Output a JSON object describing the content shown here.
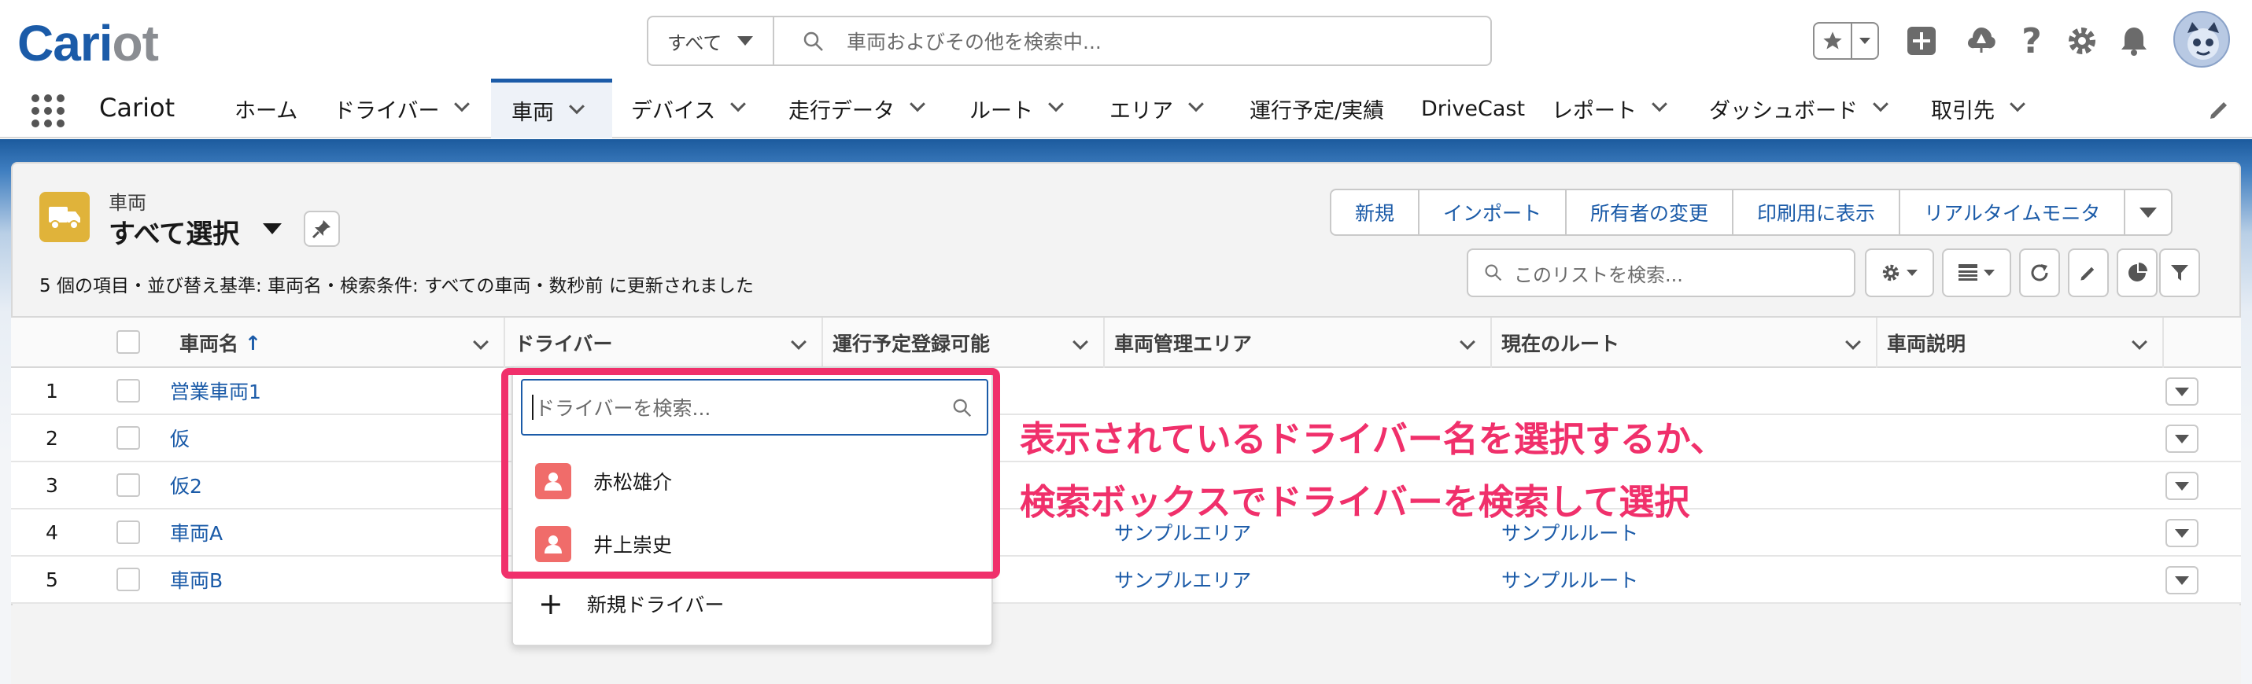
{
  "header": {
    "logo_main": "Car",
    "logo_i": "i",
    "logo_rest": "ot",
    "search_scope": "すべて",
    "search_placeholder": "車両およびその他を検索中...",
    "help_glyph": "?"
  },
  "nav": {
    "app_name": "Cariot",
    "items": [
      {
        "label": "ホーム"
      },
      {
        "label": "ドライバー"
      },
      {
        "label": "車両"
      },
      {
        "label": "デバイス"
      },
      {
        "label": "走行データ"
      },
      {
        "label": "ルート"
      },
      {
        "label": "エリア"
      },
      {
        "label": "運行予定/実績"
      },
      {
        "label": "DriveCast"
      },
      {
        "label": "レポート"
      },
      {
        "label": "ダッシュボード"
      },
      {
        "label": "取引先"
      }
    ]
  },
  "list_view": {
    "object_label": "車両",
    "title": "すべて選択",
    "status": "5 個の項目・並び替え基準: 車両名・検索条件: すべての車両・数秒前 に更新されました",
    "buttons": [
      "新規",
      "インポート",
      "所有者の変更",
      "印刷用に表示",
      "リアルタイムモニタ"
    ],
    "search_placeholder": "このリストを検索..."
  },
  "table": {
    "columns": [
      "車両名",
      "ドライバー",
      "運行予定登録可能",
      "車両管理エリア",
      "現在のルート",
      "車両説明"
    ],
    "sort_indicator": "↑",
    "rows": [
      {
        "num": "1",
        "name": "営業車両1",
        "area": "",
        "route": ""
      },
      {
        "num": "2",
        "name": "仮",
        "area": "",
        "route": ""
      },
      {
        "num": "3",
        "name": "仮2",
        "area": "",
        "route": ""
      },
      {
        "num": "4",
        "name": "車両A",
        "area": "サンプルエリア",
        "route": "サンプルルート"
      },
      {
        "num": "5",
        "name": "車両B",
        "area": "サンプルエリア",
        "route": "サンプルルート"
      }
    ]
  },
  "lookup": {
    "placeholder": "ドライバーを検索...",
    "results": [
      "赤松雄介",
      "井上崇史"
    ],
    "new_label": "新規ドライバー",
    "plus_glyph": "+"
  },
  "annotation": {
    "line1": "表示されているドライバー名を選択するか、",
    "line2": "検索ボックスでドライバーを検索して選択"
  },
  "colors": {
    "brand": "#1b5ba8",
    "highlight": "#f0306b",
    "object_icon": "#e0b33a",
    "person_icon": "#f06c6a"
  }
}
